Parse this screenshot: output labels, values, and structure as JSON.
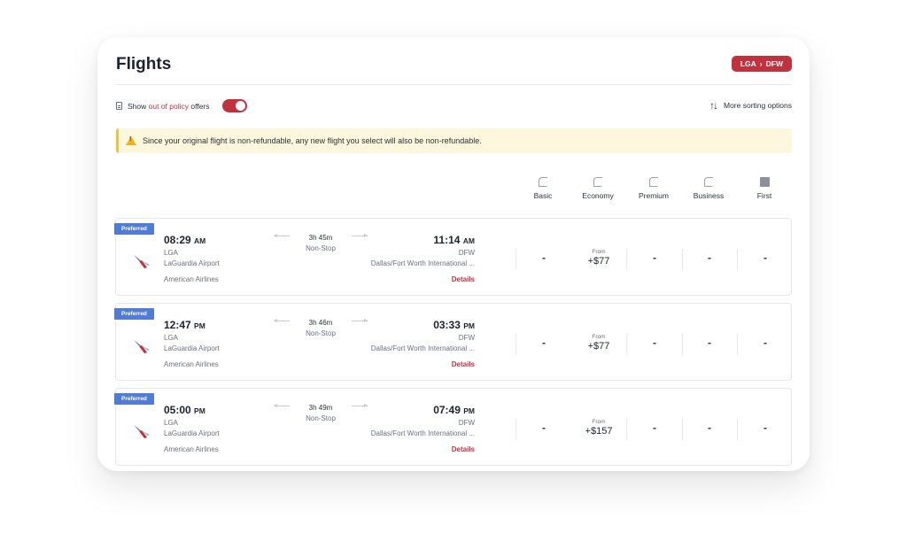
{
  "header": {
    "title": "Flights",
    "route_badge": {
      "from": "LGA",
      "separator": "›",
      "to": "DFW"
    }
  },
  "policy": {
    "prefix": "Show",
    "highlight": "out of policy",
    "suffix": "offers",
    "toggle_on": true
  },
  "sort": {
    "label": "More sorting options"
  },
  "warning": {
    "text": "Since your original flight is non-refundable, any new flight you select will also be non-refundable."
  },
  "classes": [
    "Basic",
    "Economy",
    "Premium",
    "Business",
    "First"
  ],
  "flights": [
    {
      "badge": "Preferred",
      "dep_time": "08:29",
      "dep_ampm": "AM",
      "dep_code": "LGA",
      "dep_airport": "LaGuardia Airport",
      "carrier": "American Airlines",
      "duration": "3h 45m",
      "stops": "Non-Stop",
      "arr_time": "11:14",
      "arr_ampm": "AM",
      "arr_code": "DFW",
      "arr_airport": "Dallas/Fort Worth International ...",
      "details": "Details",
      "fares": [
        "-",
        "+$77",
        "-",
        "-",
        "-"
      ],
      "fare_from_label": "From"
    },
    {
      "badge": "Preferred",
      "dep_time": "12:47",
      "dep_ampm": "PM",
      "dep_code": "LGA",
      "dep_airport": "LaGuardia Airport",
      "carrier": "American Airlines",
      "duration": "3h 46m",
      "stops": "Non-Stop",
      "arr_time": "03:33",
      "arr_ampm": "PM",
      "arr_code": "DFW",
      "arr_airport": "Dallas/Fort Worth International ...",
      "details": "Details",
      "fares": [
        "-",
        "+$77",
        "-",
        "-",
        "-"
      ],
      "fare_from_label": "From"
    },
    {
      "badge": "Preferred",
      "dep_time": "05:00",
      "dep_ampm": "PM",
      "dep_code": "LGA",
      "dep_airport": "LaGuardia Airport",
      "carrier": "American Airlines",
      "duration": "3h 49m",
      "stops": "Non-Stop",
      "arr_time": "07:49",
      "arr_ampm": "PM",
      "arr_code": "DFW",
      "arr_airport": "Dallas/Fort Worth International ...",
      "details": "Details",
      "fares": [
        "-",
        "+$157",
        "-",
        "-",
        "-"
      ],
      "fare_from_label": "From"
    }
  ],
  "colors": {
    "accent": "#c0323e",
    "preferred": "#4f7bd9",
    "warning_bg": "#fdf7dd"
  }
}
